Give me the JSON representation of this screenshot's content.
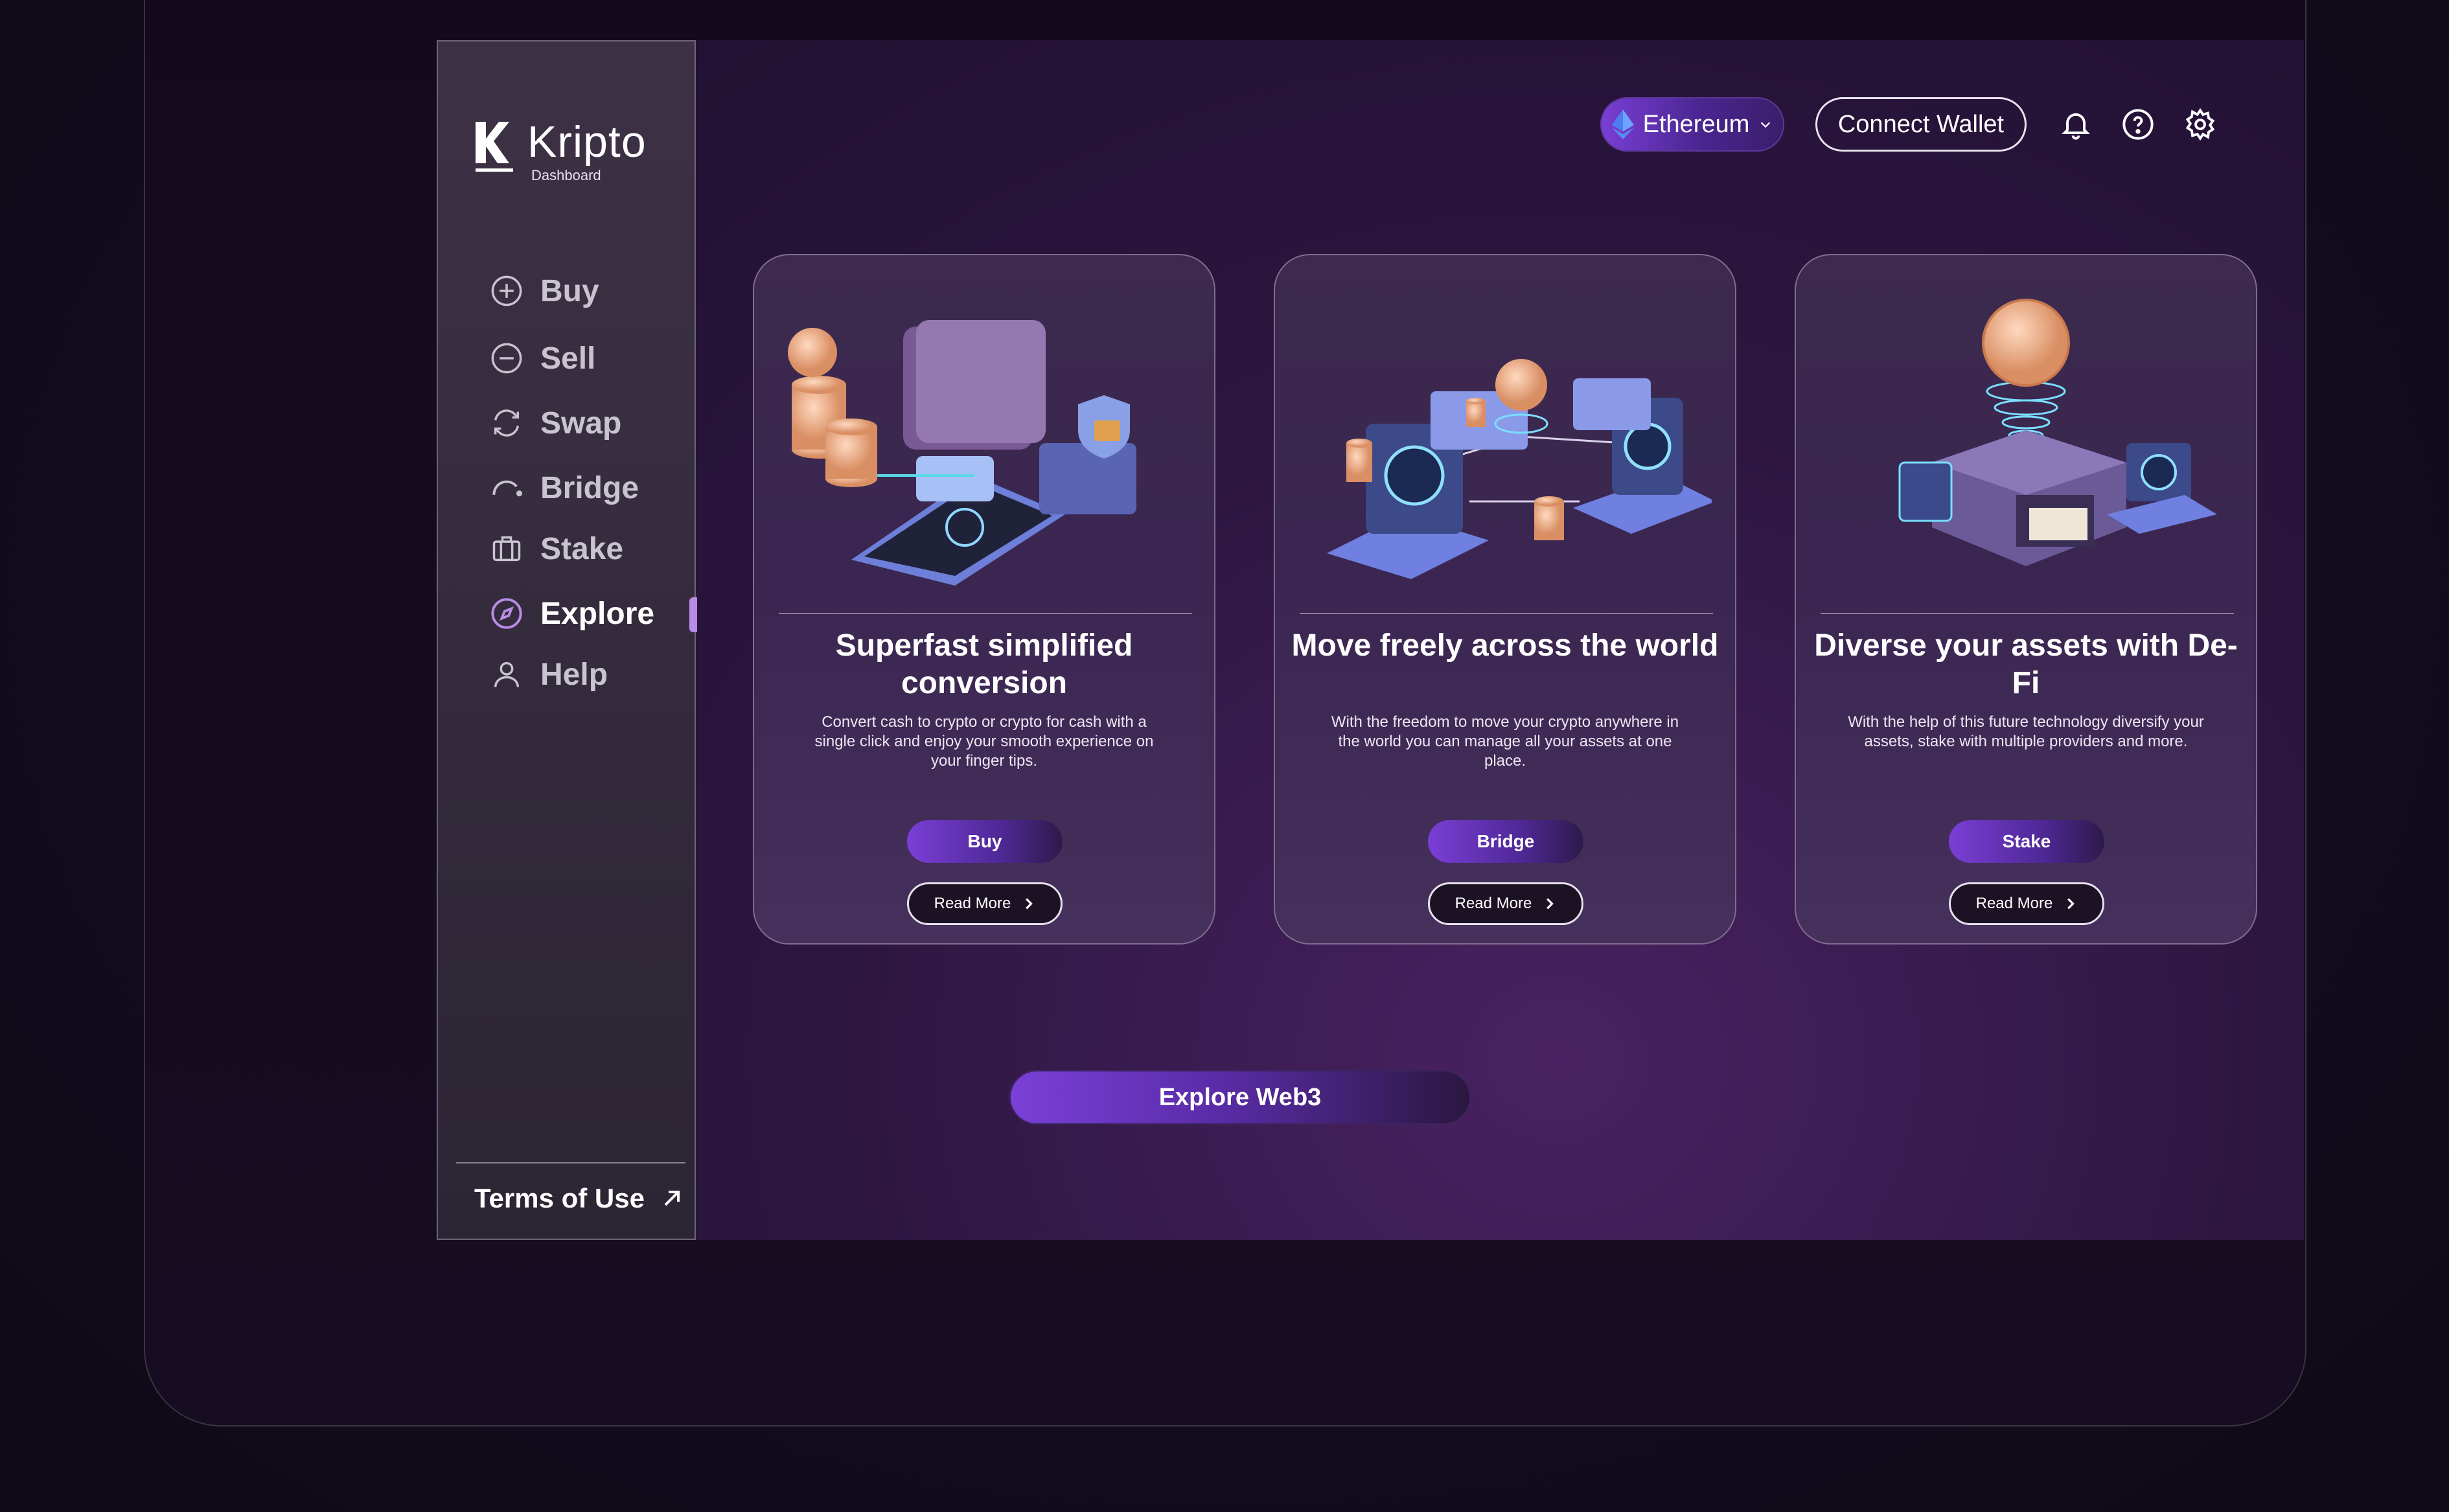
{
  "brand": {
    "name": "Kripto",
    "subtitle": "Dashboard"
  },
  "sidebar": {
    "items": [
      {
        "label": "Buy",
        "icon": "plus-circle-icon"
      },
      {
        "label": "Sell",
        "icon": "minus-circle-icon"
      },
      {
        "label": "Swap",
        "icon": "swap-arrows-icon"
      },
      {
        "label": "Bridge",
        "icon": "bridge-arc-icon"
      },
      {
        "label": "Stake",
        "icon": "briefcase-icon"
      },
      {
        "label": "Explore",
        "icon": "compass-icon",
        "active": true
      },
      {
        "label": "Help",
        "icon": "user-icon"
      }
    ],
    "terms_label": "Terms of Use"
  },
  "header": {
    "network": "Ethereum",
    "connect_wallet": "Connect Wallet",
    "icons": [
      "bell-icon",
      "help-circle-icon",
      "gear-icon"
    ]
  },
  "cards": [
    {
      "title": "Superfast simplified conversion",
      "description": "Convert cash to crypto or crypto for cash with a single click and enjoy your smooth experience on your finger tips.",
      "action": "Buy",
      "more": "Read More"
    },
    {
      "title": "Move freely across the world",
      "description": "With the freedom to move your crypto anywhere in the world you can manage all your assets at one place.",
      "action": "Bridge",
      "more": "Read More"
    },
    {
      "title": "Diverse your assets with De-Fi",
      "description": "With the help of this future technology diversify your assets, stake with multiple providers and more.",
      "action": "Stake",
      "more": "Read More"
    }
  ],
  "explore_button": "Explore Web3",
  "colors": {
    "accent": "#7a3fd6",
    "active_indicator": "#b98ce8",
    "background": "#140c1f"
  }
}
